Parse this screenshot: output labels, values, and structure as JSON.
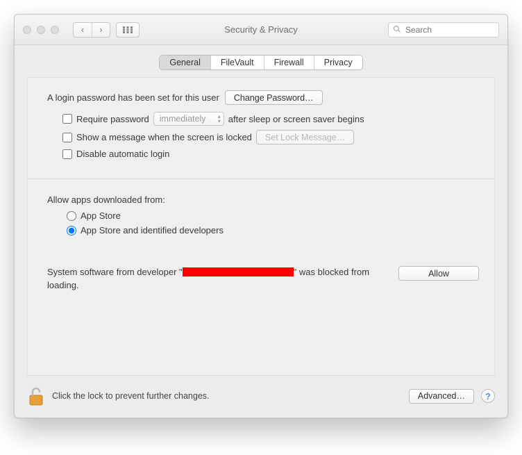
{
  "window": {
    "title": "Security & Privacy"
  },
  "toolbar": {
    "search_placeholder": "Search"
  },
  "tabs": {
    "general": "General",
    "filevault": "FileVault",
    "firewall": "Firewall",
    "privacy": "Privacy",
    "active": "general"
  },
  "login": {
    "text": "A login password has been set for this user",
    "change_btn": "Change Password…"
  },
  "options": {
    "require_pw_label_pre": "Require password",
    "require_pw_popup": "immediately",
    "require_pw_label_post": "after sleep or screen saver begins",
    "show_msg_label": "Show a message when the screen is locked",
    "set_lock_msg_btn": "Set Lock Message…",
    "disable_auto_login": "Disable automatic login"
  },
  "allow_apps": {
    "heading": "Allow apps downloaded from:",
    "opt1": "App Store",
    "opt2": "App Store and identified developers",
    "selected": "opt2"
  },
  "blocked": {
    "prefix": "System software from developer \"",
    "suffix": "\" was blocked from loading.",
    "allow_btn": "Allow"
  },
  "footer": {
    "lock_text": "Click the lock to prevent further changes.",
    "advanced_btn": "Advanced…",
    "help": "?"
  }
}
